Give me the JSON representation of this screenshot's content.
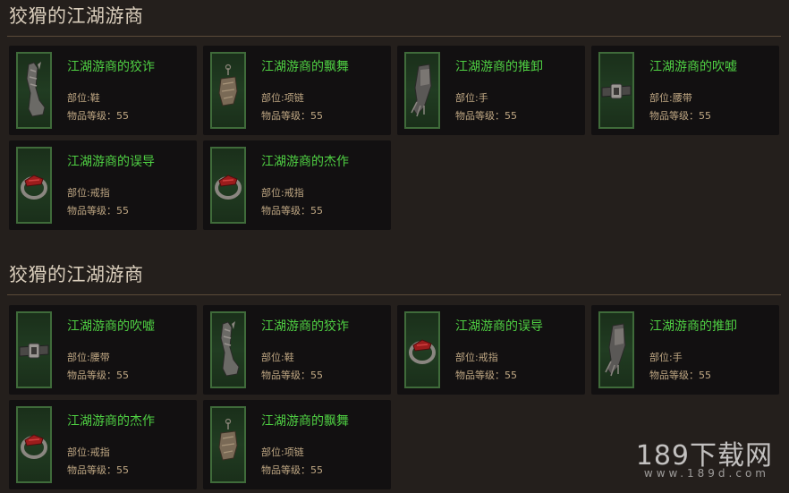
{
  "sections": [
    {
      "title": "狡猾的江湖游商",
      "items": [
        {
          "name": "江湖游商的狡诈",
          "slot": "部位:鞋",
          "level": "物品等级：55",
          "icon": "boots-icon"
        },
        {
          "name": "江湖游商的飘舞",
          "slot": "部位:项链",
          "level": "物品等级：55",
          "icon": "amulet-icon"
        },
        {
          "name": "江湖游商的推卸",
          "slot": "部位:手",
          "level": "物品等级：55",
          "icon": "gloves-icon"
        },
        {
          "name": "江湖游商的吹嘘",
          "slot": "部位:腰带",
          "level": "物品等级：55",
          "icon": "belt-icon"
        },
        {
          "name": "江湖游商的误导",
          "slot": "部位:戒指",
          "level": "物品等级：55",
          "icon": "ring-icon"
        },
        {
          "name": "江湖游商的杰作",
          "slot": "部位:戒指",
          "level": "物品等级：55",
          "icon": "ring-icon"
        }
      ]
    },
    {
      "title": "狡猾的江湖游商",
      "items": [
        {
          "name": "江湖游商的吹嘘",
          "slot": "部位:腰带",
          "level": "物品等级：55",
          "icon": "belt-icon"
        },
        {
          "name": "江湖游商的狡诈",
          "slot": "部位:鞋",
          "level": "物品等级：55",
          "icon": "boots-icon"
        },
        {
          "name": "江湖游商的误导",
          "slot": "部位:戒指",
          "level": "物品等级：55",
          "icon": "ring-icon"
        },
        {
          "name": "江湖游商的推卸",
          "slot": "部位:手",
          "level": "物品等级：55",
          "icon": "gloves-icon"
        },
        {
          "name": "江湖游商的杰作",
          "slot": "部位:戒指",
          "level": "物品等级：55",
          "icon": "ring-icon"
        },
        {
          "name": "江湖游商的飘舞",
          "slot": "部位:项链",
          "level": "物品等级：55",
          "icon": "amulet-icon"
        }
      ]
    }
  ],
  "watermark": {
    "main": "189下载网",
    "url": "www.189d.com"
  },
  "colors": {
    "background": "#241f1c",
    "card": "#121011",
    "item_name": "#4fd043",
    "item_meta": "#c0a884",
    "thumb_border": "#3f6b3a"
  }
}
